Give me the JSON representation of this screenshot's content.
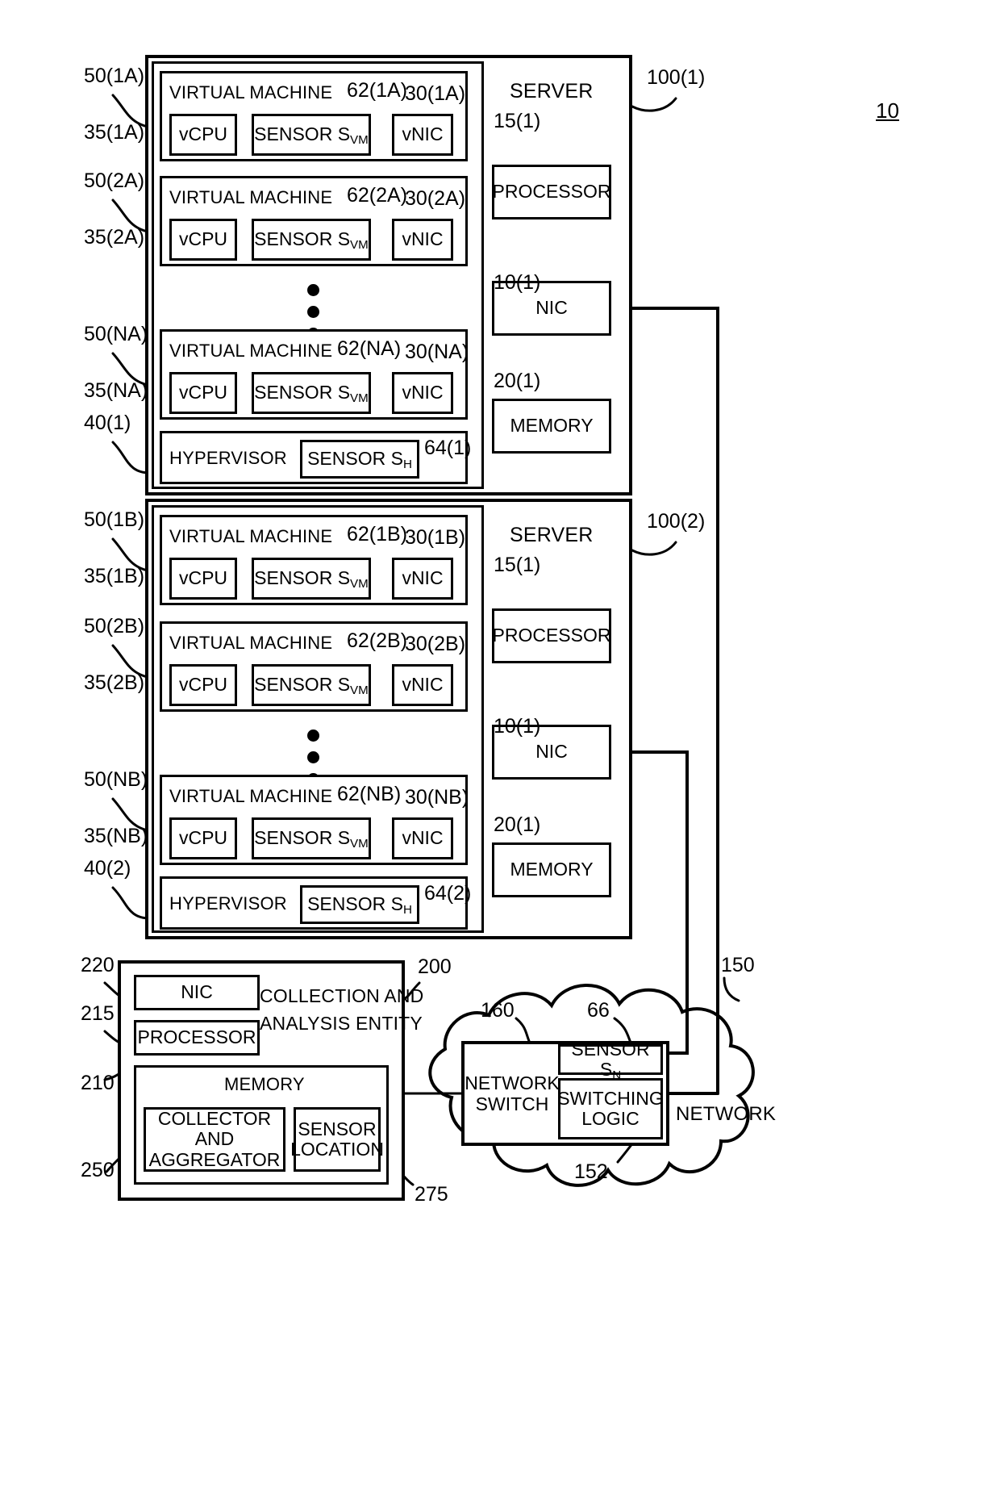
{
  "figure": {
    "number": "10"
  },
  "servers": [
    {
      "title": "SERVER",
      "ref": "100(1)",
      "vms": [
        {
          "title": "VIRTUAL MACHINE",
          "ref_vm": "50(1A)",
          "ref_vcpu": "35(1A)",
          "ref_sensor": "62(1A)",
          "ref_vnic": "30(1A)",
          "vcpu": "vCPU",
          "sensor": "SENSOR S",
          "sensor_sub": "VM",
          "vnic": "vNIC"
        },
        {
          "title": "VIRTUAL MACHINE",
          "ref_vm": "50(2A)",
          "ref_vcpu": "35(2A)",
          "ref_sensor": "62(2A)",
          "ref_vnic": "30(2A)",
          "vcpu": "vCPU",
          "sensor": "SENSOR S",
          "sensor_sub": "VM",
          "vnic": "vNIC"
        },
        {
          "title": "VIRTUAL MACHINE",
          "ref_vm": "50(NA)",
          "ref_vcpu": "35(NA)",
          "ref_sensor": "62(NA)",
          "ref_vnic": "30(NA)",
          "vcpu": "vCPU",
          "sensor": "SENSOR S",
          "sensor_sub": "VM",
          "vnic": "vNIC"
        }
      ],
      "hypervisor": {
        "label": "HYPERVISOR",
        "ref": "40(1)",
        "sensor": "SENSOR S",
        "sensor_sub": "H",
        "sensor_ref": "64(1)"
      },
      "processor": {
        "label": "PROCESSOR",
        "ref": "15(1)"
      },
      "nic": {
        "label": "NIC",
        "ref": "10(1)"
      },
      "memory": {
        "label": "MEMORY",
        "ref": "20(1)"
      }
    },
    {
      "title": "SERVER",
      "ref": "100(2)",
      "vms": [
        {
          "title": "VIRTUAL MACHINE",
          "ref_vm": "50(1B)",
          "ref_vcpu": "35(1B)",
          "ref_sensor": "62(1B)",
          "ref_vnic": "30(1B)",
          "vcpu": "vCPU",
          "sensor": "SENSOR S",
          "sensor_sub": "VM",
          "vnic": "vNIC"
        },
        {
          "title": "VIRTUAL MACHINE",
          "ref_vm": "50(2B)",
          "ref_vcpu": "35(2B)",
          "ref_sensor": "62(2B)",
          "ref_vnic": "30(2B)",
          "vcpu": "vCPU",
          "sensor": "SENSOR S",
          "sensor_sub": "VM",
          "vnic": "vNIC"
        },
        {
          "title": "VIRTUAL MACHINE",
          "ref_vm": "50(NB)",
          "ref_vcpu": "35(NB)",
          "ref_sensor": "62(NB)",
          "ref_vnic": "30(NB)",
          "vcpu": "vCPU",
          "sensor": "SENSOR S",
          "sensor_sub": "VM",
          "vnic": "vNIC"
        }
      ],
      "hypervisor": {
        "label": "HYPERVISOR",
        "ref": "40(2)",
        "sensor": "SENSOR S",
        "sensor_sub": "H",
        "sensor_ref": "64(2)"
      },
      "processor": {
        "label": "PROCESSOR",
        "ref": "15(1)"
      },
      "nic": {
        "label": "NIC",
        "ref": "10(1)"
      },
      "memory": {
        "label": "MEMORY",
        "ref": "20(1)"
      }
    }
  ],
  "collection_entity": {
    "title_line1": "COLLECTION AND",
    "title_line2": "ANALYSIS ENTITY",
    "ref": "200",
    "nic": {
      "label": "NIC",
      "ref": "220"
    },
    "processor": {
      "label": "PROCESSOR",
      "ref": "215"
    },
    "memory": {
      "label": "MEMORY",
      "ref": "210"
    },
    "collector": {
      "line1": "COLLECTOR AND",
      "line2": "AGGREGATOR",
      "ref": "250"
    },
    "sensor_location": {
      "line1": "SENSOR",
      "line2": "LOCATION",
      "ref": "275"
    }
  },
  "network": {
    "label": "NETWORK",
    "ref": "150",
    "switch": {
      "line1": "NETWORK",
      "line2": "SWITCH",
      "ref": "160"
    },
    "sensor": {
      "label": "SENSOR S",
      "sub": "N",
      "ref": "66"
    },
    "switching_logic": {
      "line1": "SWITCHING",
      "line2": "LOGIC",
      "ref": "152"
    }
  }
}
